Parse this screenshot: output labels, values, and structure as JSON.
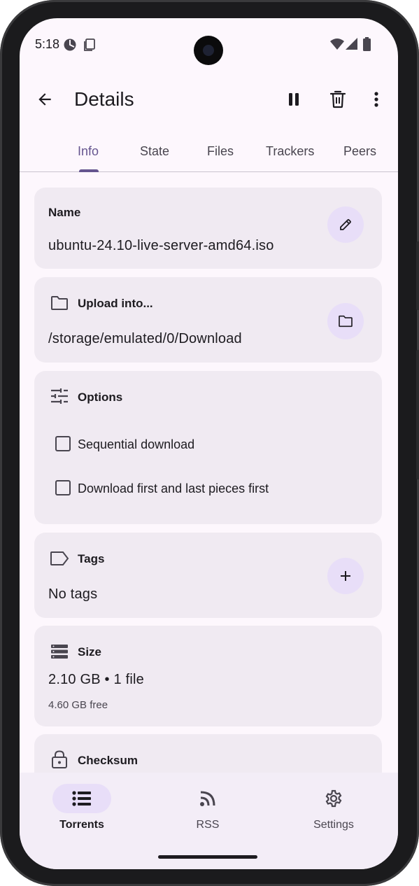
{
  "status_bar": {
    "time": "5:18"
  },
  "app_bar": {
    "title": "Details"
  },
  "tabs": [
    {
      "label": "Info",
      "active": true
    },
    {
      "label": "State",
      "active": false
    },
    {
      "label": "Files",
      "active": false
    },
    {
      "label": "Trackers",
      "active": false
    },
    {
      "label": "Peers",
      "active": false
    }
  ],
  "name_card": {
    "label": "Name",
    "value": "ubuntu-24.10-live-server-amd64.iso"
  },
  "location_card": {
    "label": "Upload into...",
    "value": "/storage/emulated/0/Download"
  },
  "options_card": {
    "label": "Options",
    "options": [
      {
        "label": "Sequential download",
        "checked": false
      },
      {
        "label": "Download first and last pieces first",
        "checked": false
      }
    ]
  },
  "tags_card": {
    "label": "Tags",
    "value": "No tags"
  },
  "size_card": {
    "label": "Size",
    "value": "2.10 GB • 1 file",
    "free": "4.60 GB free"
  },
  "checksum_card": {
    "label": "Checksum"
  },
  "bottom_nav": [
    {
      "label": "Torrents",
      "icon": "list-icon",
      "active": true
    },
    {
      "label": "RSS",
      "icon": "rss-icon",
      "active": false
    },
    {
      "label": "Settings",
      "icon": "gear-icon",
      "active": false
    }
  ],
  "colors": {
    "accent": "#65558f",
    "surface": "#fdf7fd",
    "card": "#f0eaf2",
    "tonal": "#e8def8"
  }
}
